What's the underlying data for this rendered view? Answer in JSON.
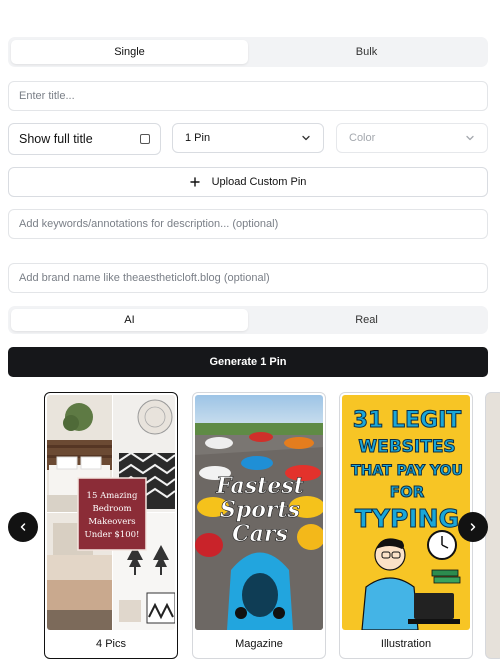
{
  "mode_tabs": {
    "single": "Single",
    "bulk": "Bulk"
  },
  "title_input": {
    "placeholder": "Enter title..."
  },
  "show_full_title": {
    "label": "Show full title",
    "checked": false
  },
  "pin_count_select": {
    "value": "1 Pin"
  },
  "color_select": {
    "placeholder": "Color"
  },
  "upload_button": {
    "label": "Upload Custom Pin"
  },
  "keywords_input": {
    "placeholder": "Add keywords/annotations for description... (optional)"
  },
  "brand_input": {
    "placeholder": "Add brand name like theaestheticloft.blog (optional)"
  },
  "image_mode_tabs": {
    "ai": "AI",
    "real": "Real"
  },
  "generate_button": {
    "label": "Generate 1 Pin"
  },
  "templates": [
    {
      "name": "4 Pics",
      "selected": true,
      "overlay_text": "15 Amazing Bedroom Makeovers Under $100!",
      "overlay_color": "#8b2c37"
    },
    {
      "name": "Magazine",
      "selected": false,
      "overlay_text": "Fastest Sports Cars"
    },
    {
      "name": "Illustration",
      "selected": false,
      "overlay_text": "31 LEGIT WEBSITES THAT PAY YOU FOR TYPING",
      "bg_color": "#f7c525",
      "text_color": "#1aa7d8"
    }
  ]
}
